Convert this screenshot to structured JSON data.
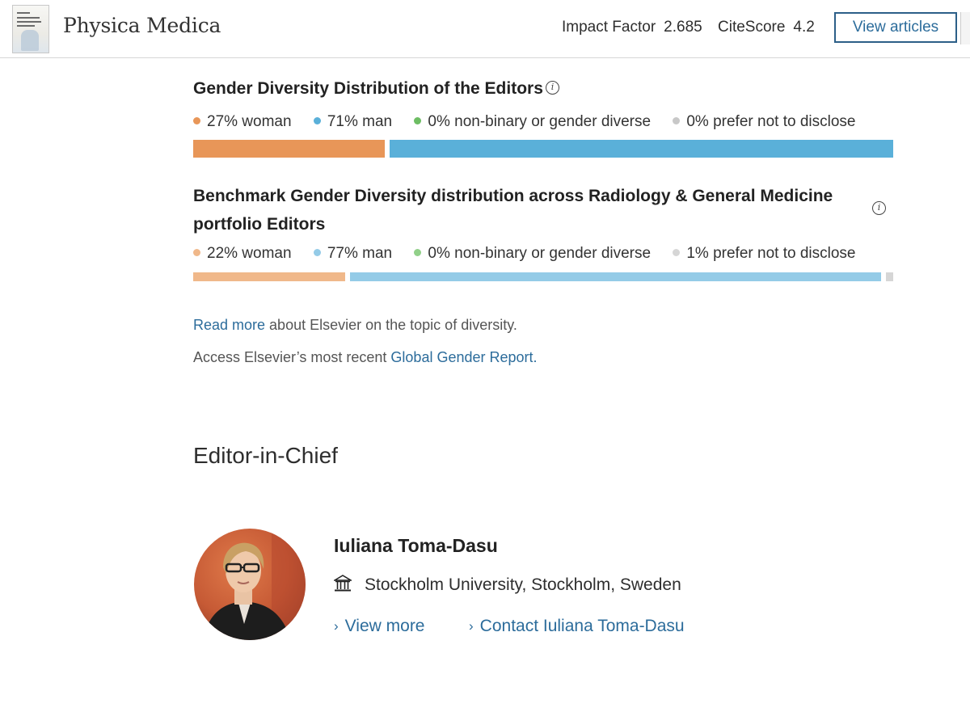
{
  "header": {
    "journal_title": "Physica Medica",
    "impact_factor_label": "Impact Factor",
    "impact_factor_value": "2.685",
    "citescore_label": "CiteScore",
    "citescore_value": "4.2",
    "view_articles_label": "View articles"
  },
  "diversity": {
    "editors": {
      "title": "Gender Diversity Distribution of the Editors",
      "legend": [
        {
          "label": "27% woman",
          "value": 27,
          "color": "#e89658"
        },
        {
          "label": "71% man",
          "value": 71,
          "color": "#5ab0d9"
        },
        {
          "label": "0% non-binary or gender diverse",
          "value": 0,
          "color": "#6dbd63"
        },
        {
          "label": "0% prefer not to disclose",
          "value": 0,
          "color": "#c8c8c8"
        }
      ]
    },
    "benchmark": {
      "title_line1": "Benchmark Gender Diversity distribution across Radiology & General Medicine",
      "title_line2": "portfolio Editors",
      "legend": [
        {
          "label": "22% woman",
          "value": 22,
          "color": "#f0b88a"
        },
        {
          "label": "77% man",
          "value": 77,
          "color": "#94cbe7"
        },
        {
          "label": "0% non-binary or gender diverse",
          "value": 0,
          "color": "#91d089"
        },
        {
          "label": "1% prefer not to disclose",
          "value": 1,
          "color": "#d6d6d6"
        }
      ]
    }
  },
  "links": {
    "read_more_link": "Read more",
    "read_more_rest": " about Elsevier on the topic of diversity.",
    "access_prefix": "Access Elsevier’s most recent ",
    "global_report_link": "Global Gender Report",
    "access_suffix": "."
  },
  "editor_section": {
    "heading": "Editor-in-Chief",
    "name": "Iuliana Toma-Dasu",
    "affiliation": "Stockholm University, Stockholm, Sweden",
    "view_more": "View more",
    "contact": "Contact Iuliana Toma-Dasu"
  },
  "icons": {
    "info": "info-icon",
    "institution": "institution-icon",
    "chevron": "chevron-right-icon"
  }
}
